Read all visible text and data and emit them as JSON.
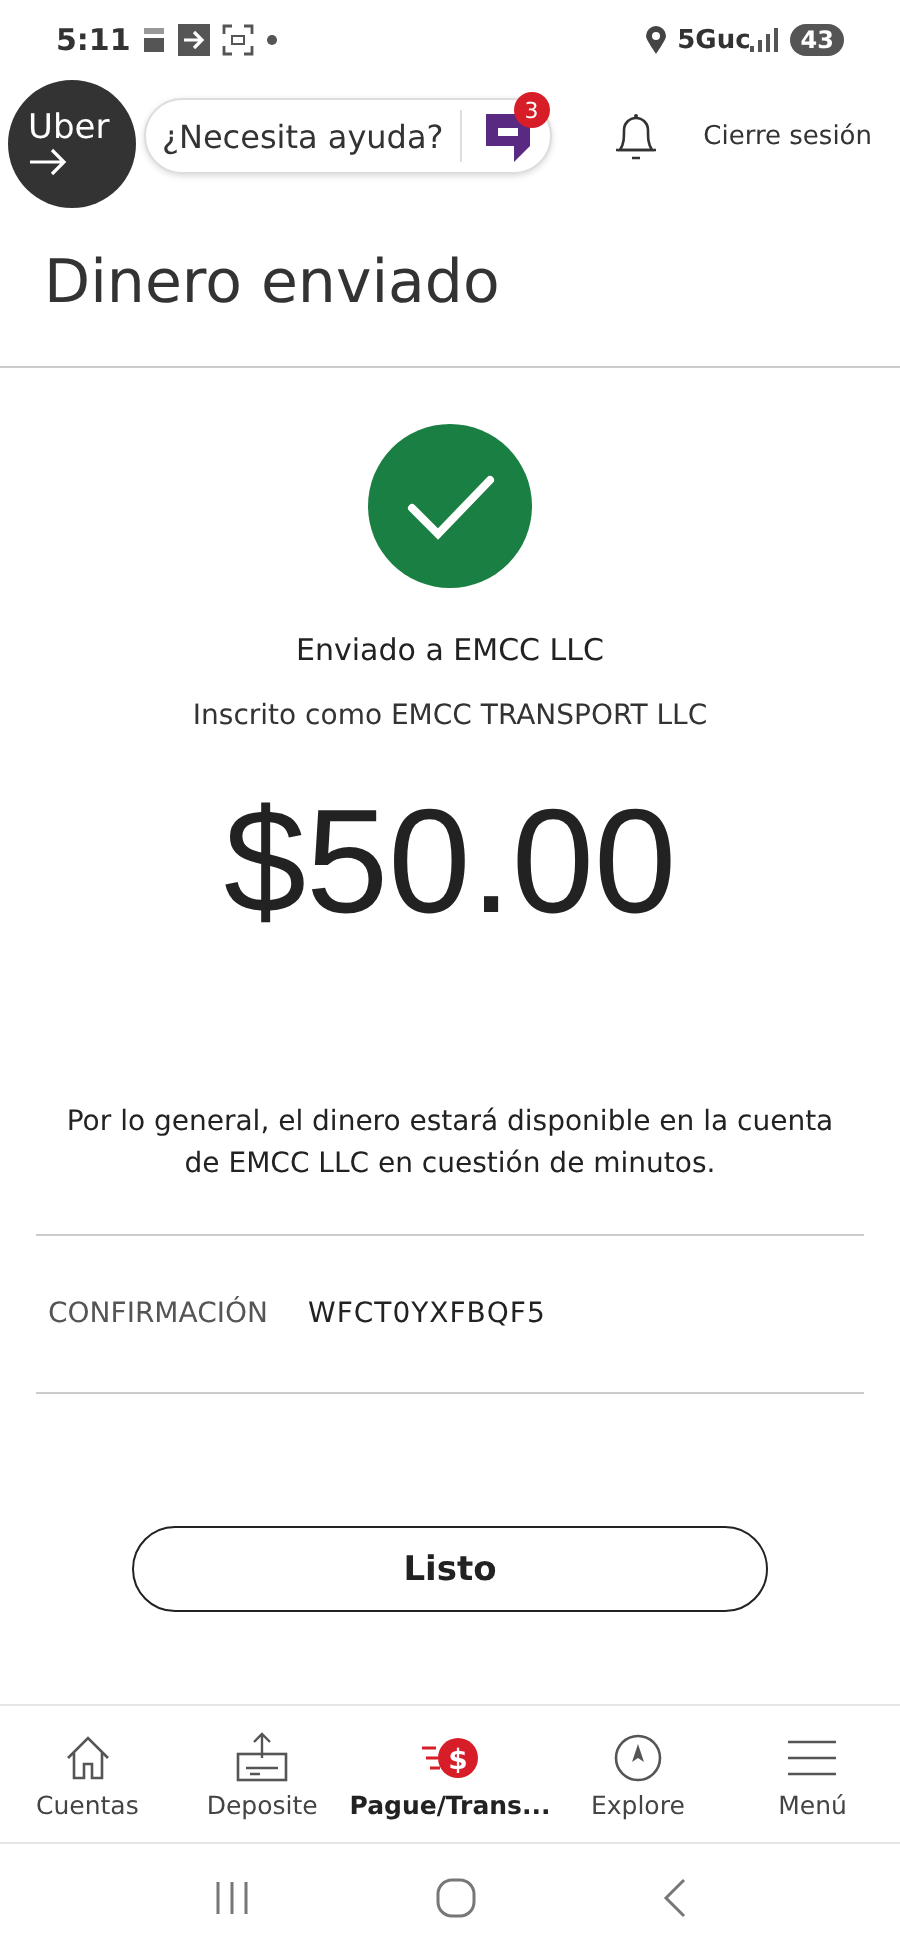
{
  "status_bar": {
    "time": "5:11",
    "network": "5Guc",
    "battery": "43"
  },
  "floating_bubble": {
    "label": "Uber"
  },
  "header": {
    "help": "¿Necesita ayuda?",
    "chat_badge": "3",
    "logout": "Cierre sesión"
  },
  "title": "Dinero enviado",
  "result": {
    "sent_to": "Enviado a EMCC LLC",
    "enrolled_as": "Inscrito como EMCC TRANSPORT LLC",
    "amount": "$50.00",
    "message": "Por lo general, el dinero estará disponible en la cuenta de EMCC LLC en cuestión de minutos."
  },
  "confirmation": {
    "label": "CONFIRMACIÓN",
    "value": "WFCT0YXFBQF5"
  },
  "done_button": "Listo",
  "bottom_nav": [
    {
      "kind": "home",
      "label": "Cuentas",
      "selected": false
    },
    {
      "kind": "deposit",
      "label": "Deposite",
      "selected": false
    },
    {
      "kind": "pay",
      "label": "Pague/Trans...",
      "symbol": "$",
      "selected": true
    },
    {
      "kind": "explore",
      "label": "Explore",
      "selected": false
    },
    {
      "kind": "menu",
      "label": "Menú",
      "selected": false
    }
  ]
}
